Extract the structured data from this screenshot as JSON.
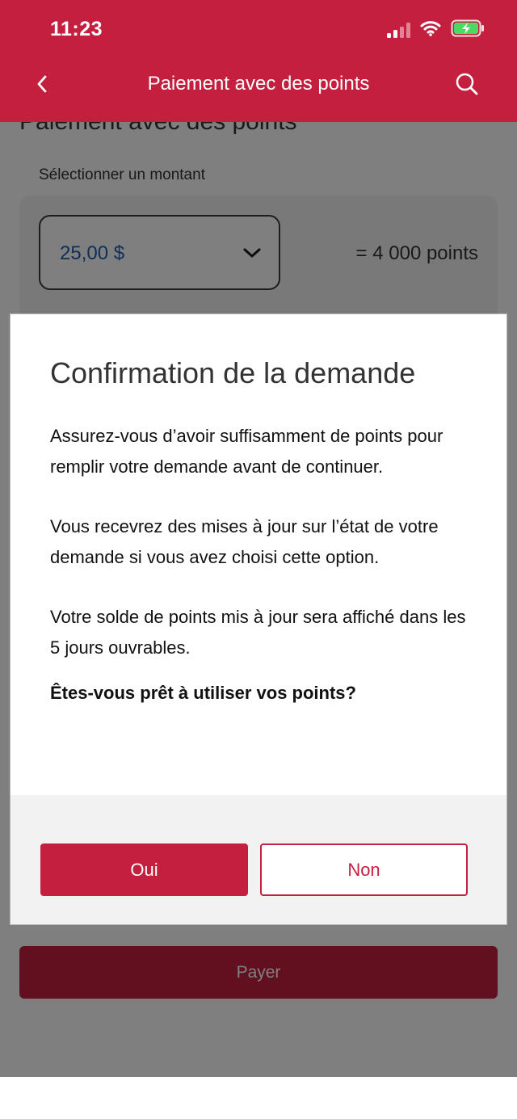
{
  "colors": {
    "brand_red": "#c41f3e",
    "dark_red": "#640c1c",
    "white": "#ffffff",
    "modal_footer_gray": "#f2f2f2",
    "amount_blue": "#1f5fae",
    "battery_green": "#4cd964"
  },
  "status_bar": {
    "time": "11:23",
    "icons": [
      "cellular-signal-icon",
      "wifi-icon",
      "battery-charging-icon"
    ]
  },
  "nav": {
    "back_icon": "chevron-left-icon",
    "title": "Paiement avec des points",
    "search_icon": "search-icon"
  },
  "page": {
    "title": "Paiement avec des points",
    "amount_label": "Sélectionner un montant",
    "amount_selected": "25,00 $",
    "dropdown_icon": "chevron-down-icon",
    "points_equivalent": "=  4 000 points",
    "pay_label": "Payer"
  },
  "modal": {
    "title": "Confirmation de la demande",
    "paragraphs": [
      "Assurez-vous d’avoir suffisamment de points pour remplir votre demande avant de continuer.",
      "Vous recevrez des mises à jour sur l’état de votre demande si vous avez choisi cette option.",
      "Votre solde de points mis à jour sera affiché dans les 5 jours ouvrables."
    ],
    "question": "Êtes-vous prêt à utiliser vos points?",
    "yes_label": "Oui",
    "no_label": "Non"
  }
}
